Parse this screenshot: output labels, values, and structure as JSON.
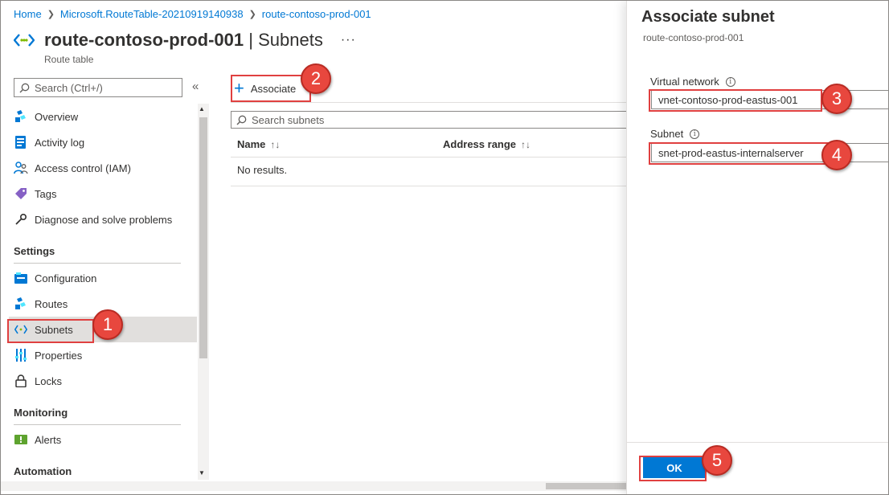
{
  "breadcrumb": {
    "items": [
      "Home",
      "Microsoft.RouteTable-20210919140938",
      "route-contoso-prod-001"
    ]
  },
  "header": {
    "resource_name": "route-contoso-prod-001",
    "page_name": "Subnets",
    "separator": "|",
    "more": "···",
    "resource_type": "Route table"
  },
  "sidebar": {
    "search_placeholder": "Search (Ctrl+/)",
    "collapse": "«",
    "items": [
      {
        "label": "Overview",
        "icon": "overview-icon"
      },
      {
        "label": "Activity log",
        "icon": "activity-log-icon"
      },
      {
        "label": "Access control (IAM)",
        "icon": "people-icon"
      },
      {
        "label": "Tags",
        "icon": "tag-icon"
      },
      {
        "label": "Diagnose and solve problems",
        "icon": "wrench-icon"
      }
    ],
    "sections": [
      {
        "title": "Settings",
        "items": [
          {
            "label": "Configuration",
            "icon": "configuration-icon"
          },
          {
            "label": "Routes",
            "icon": "routes-icon"
          },
          {
            "label": "Subnets",
            "icon": "subnets-icon",
            "active": true
          },
          {
            "label": "Properties",
            "icon": "properties-icon"
          },
          {
            "label": "Locks",
            "icon": "lock-icon"
          }
        ]
      },
      {
        "title": "Monitoring",
        "items": [
          {
            "label": "Alerts",
            "icon": "alerts-icon"
          }
        ]
      },
      {
        "title": "Automation",
        "items": []
      }
    ]
  },
  "main": {
    "associate_label": "Associate",
    "search_placeholder": "Search subnets",
    "columns": [
      {
        "label": "Name",
        "sort": "↑↓"
      },
      {
        "label": "Address range",
        "sort": "↑↓"
      }
    ],
    "empty_text": "No results."
  },
  "blade": {
    "title": "Associate subnet",
    "subtitle": "route-contoso-prod-001",
    "vnet_label": "Virtual network",
    "vnet_value": "vnet-contoso-prod-eastus-001",
    "subnet_label": "Subnet",
    "subnet_value": "snet-prod-eastus-internalserver",
    "info_glyph": "i",
    "ok_label": "OK"
  },
  "annotations": [
    "1",
    "2",
    "3",
    "4",
    "5"
  ],
  "colors": {
    "accent": "#0078d4",
    "highlight": "#e04040",
    "badge": "#e8473e"
  }
}
